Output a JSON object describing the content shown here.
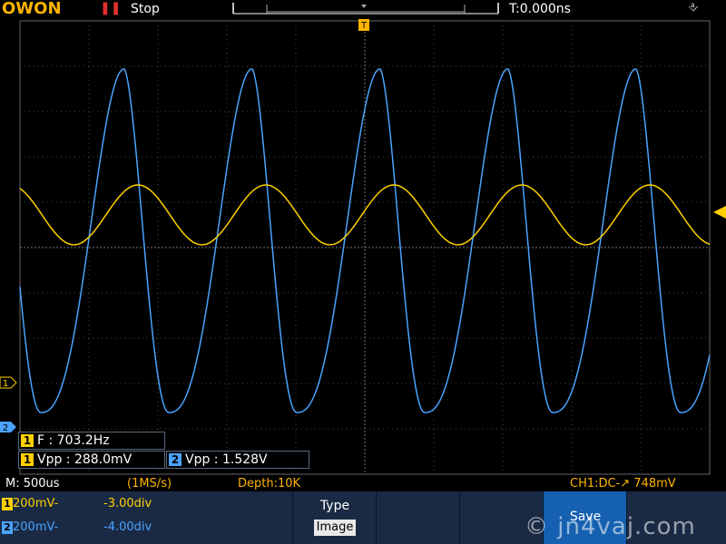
{
  "header": {
    "brand": "OWON",
    "run_icon": "pause-icon",
    "run_state": "Stop",
    "time_offset": "T:0.000ns",
    "usb_icon": "usb-icon"
  },
  "markers": {
    "trigger_top": "T",
    "ch1_marker": "1",
    "ch2_marker": "2"
  },
  "measurements": [
    {
      "channel": "1",
      "text": "F : 703.2Hz"
    },
    {
      "channel": "1",
      "text": "Vpp : 288.0mV"
    },
    {
      "channel": "2",
      "text": "Vpp : 1.528V"
    }
  ],
  "info": {
    "timebase": "M: 500us",
    "sample_rate": "(1MS/s)",
    "depth": "Depth:10K",
    "trigger": "CH1:DC-↗ 748mV"
  },
  "channels": [
    {
      "id": "1",
      "volts": "200mV-",
      "position": "-3.00div"
    },
    {
      "id": "2",
      "volts": "200mV-",
      "position": "-4.00div"
    }
  ],
  "menu": {
    "type_label": "Type",
    "type_value": "Image",
    "save_label": "Save"
  },
  "watermark": "© jn4vaj.com",
  "colors": {
    "ch1": "#ffd000",
    "ch2": "#4aa3ff",
    "accent": "#ffb400",
    "menu_bg": "#1a2a44",
    "save_bg": "#1560b0"
  },
  "chart_data": {
    "type": "line",
    "xlabel": "",
    "ylabel": "",
    "grid": true,
    "series": [
      {
        "channel": "1",
        "shape": "sine",
        "cycles": 5.3,
        "vpp_mV": 288.0,
        "freq_hz": 703.2
      },
      {
        "channel": "2",
        "shape": "asymmetric-triangle",
        "cycles": 5.3,
        "vpp_V": 1.528
      }
    ]
  }
}
